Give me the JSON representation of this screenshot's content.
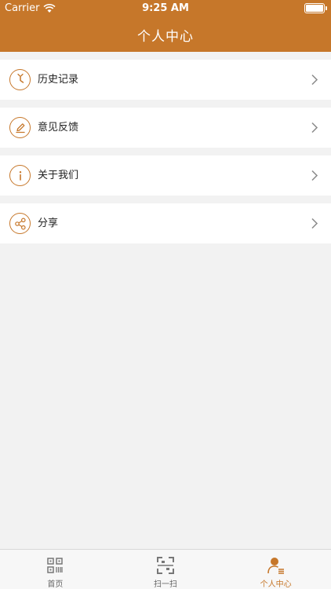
{
  "status": {
    "carrier": "Carrier",
    "time": "9:25 AM"
  },
  "nav": {
    "title": "个人中心"
  },
  "menu": [
    {
      "label": "历史记录",
      "icon": "clock-icon"
    },
    {
      "label": "意见反馈",
      "icon": "edit-icon"
    },
    {
      "label": "关于我们",
      "icon": "info-icon"
    },
    {
      "label": "分享",
      "icon": "share-icon"
    }
  ],
  "tabs": [
    {
      "label": "首页",
      "icon": "qr-code-icon",
      "active": false
    },
    {
      "label": "扫一扫",
      "icon": "scan-icon",
      "active": false
    },
    {
      "label": "个人中心",
      "icon": "user-profile-icon",
      "active": true
    }
  ],
  "colors": {
    "accent": "#c6772a",
    "background": "#f2f2f2",
    "inactive": "#666666"
  }
}
